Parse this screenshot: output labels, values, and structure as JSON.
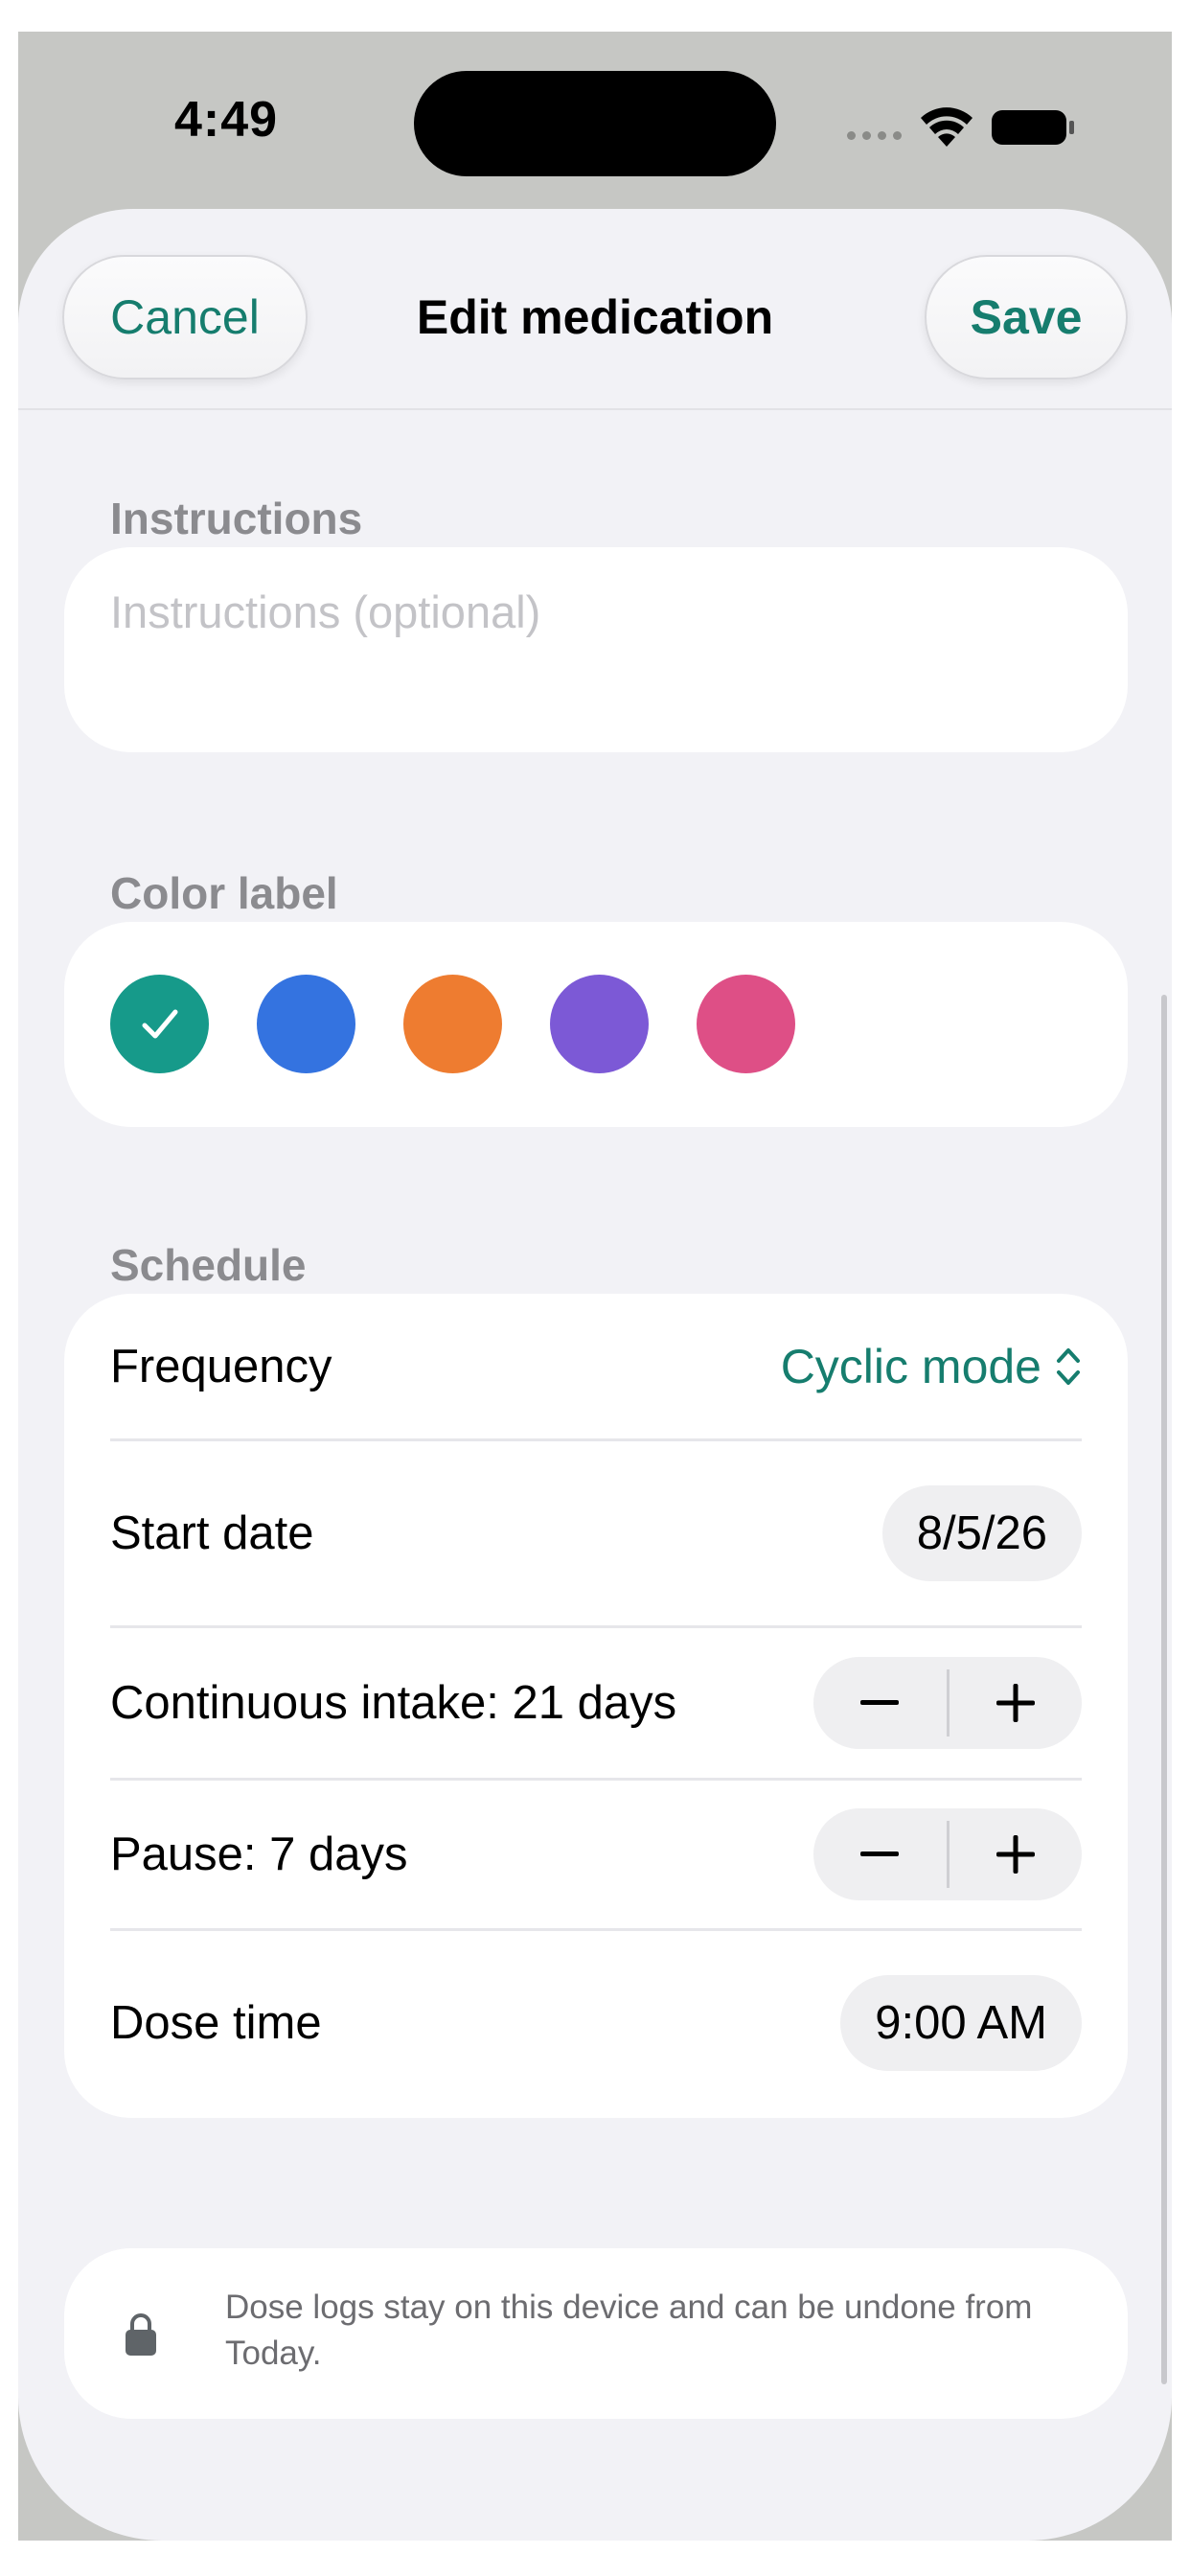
{
  "status_bar": {
    "time": "4:49",
    "wifi_icon": "wifi-icon",
    "battery_icon": "battery-icon"
  },
  "nav": {
    "cancel_label": "Cancel",
    "title": "Edit medication",
    "save_label": "Save"
  },
  "instructions": {
    "section_label": "Instructions",
    "placeholder": "Instructions (optional)",
    "value": ""
  },
  "color_label": {
    "section_label": "Color label",
    "colors": [
      "#169a8a",
      "#3473e0",
      "#ee7c30",
      "#7c59d6",
      "#de4f86"
    ],
    "selected_index": 0
  },
  "schedule": {
    "section_label": "Schedule",
    "frequency_label": "Frequency",
    "frequency_value": "Cyclic mode",
    "start_date_label": "Start date",
    "start_date_value": "8/5/26",
    "continuous_label": "Continuous intake: 21 days",
    "pause_label": "Pause: 7 days",
    "dose_time_label": "Dose time",
    "dose_time_value": "9:00 AM"
  },
  "footer": {
    "note": "Dose logs stay on this device and can be undone from Today.",
    "icon": "lock-icon"
  },
  "colors": {
    "accent": "#167d6e",
    "secondary_text": "#8b8b8f",
    "background": "#f2f2f6"
  }
}
